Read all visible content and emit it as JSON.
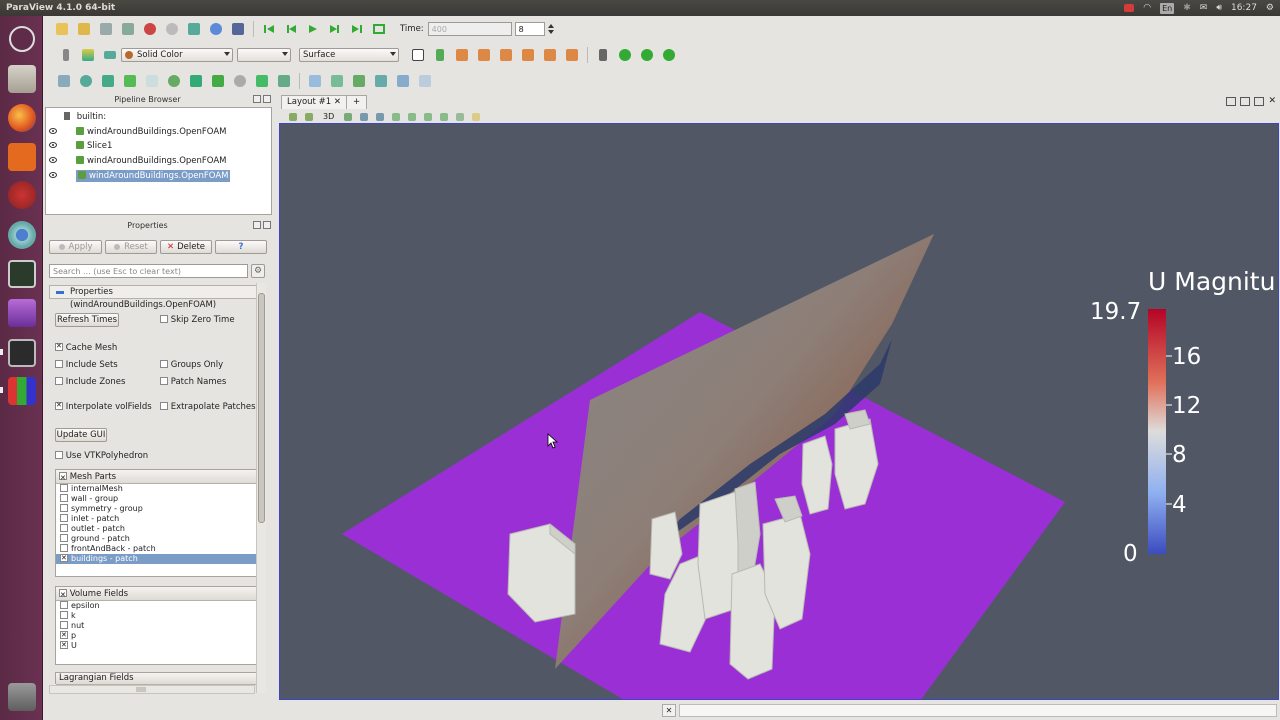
{
  "window_title": "ParaView 4.1.0 64-bit",
  "tray": {
    "lang": "En",
    "time": "16:27"
  },
  "time_toolbar": {
    "label": "Time:",
    "value": "400",
    "step": "8"
  },
  "representation_toolbar": {
    "color_by": "Solid Color",
    "component": "",
    "representation": "Surface"
  },
  "pipeline_browser": {
    "title": "Pipeline Browser",
    "root": "builtin:",
    "items": [
      {
        "label": "windAroundBuildings.OpenFOAM",
        "selected": false
      },
      {
        "label": "Slice1",
        "selected": false
      },
      {
        "label": "windAroundBuildings.OpenFOAM",
        "selected": false
      },
      {
        "label": "windAroundBuildings.OpenFOAM",
        "selected": true
      }
    ]
  },
  "properties_panel": {
    "title": "Properties",
    "apply": "Apply",
    "reset": "Reset",
    "delete": "Delete",
    "help": "?",
    "search_placeholder": "Search ... (use Esc to clear text)",
    "section_header": "Properties (windAroundBuildings.OpenFOAM)",
    "refresh_times": "Refresh Times",
    "skip_zero_time": "Skip Zero Time",
    "cache_mesh": "Cache Mesh",
    "include_sets": "Include Sets",
    "groups_only": "Groups Only",
    "include_zones": "Include Zones",
    "patch_names": "Patch Names",
    "interpolate_volfields": "Interpolate volFields",
    "extrapolate_patches": "Extrapolate Patches",
    "update_gui": "Update GUI",
    "use_vtkpolyhedron": "Use VTKPolyhedron",
    "mesh_parts_header": "Mesh Parts",
    "mesh_parts": [
      {
        "label": "internalMesh",
        "checked": false,
        "selected": false
      },
      {
        "label": "wall - group",
        "checked": false,
        "selected": false
      },
      {
        "label": "symmetry - group",
        "checked": false,
        "selected": false
      },
      {
        "label": "inlet - patch",
        "checked": false,
        "selected": false
      },
      {
        "label": "outlet - patch",
        "checked": false,
        "selected": false
      },
      {
        "label": "ground - patch",
        "checked": false,
        "selected": false
      },
      {
        "label": "frontAndBack - patch",
        "checked": false,
        "selected": false
      },
      {
        "label": "buildings - patch",
        "checked": true,
        "selected": true
      }
    ],
    "volume_fields_header": "Volume Fields",
    "volume_fields": [
      {
        "label": "epsilon",
        "checked": false
      },
      {
        "label": "k",
        "checked": false
      },
      {
        "label": "nut",
        "checked": false
      },
      {
        "label": "p",
        "checked": true
      },
      {
        "label": "U",
        "checked": true
      }
    ],
    "lagrangian_fields_header": "Lagrangian Fields"
  },
  "layout_tab": {
    "label": "Layout #1",
    "add": "+"
  },
  "view_toolbar": {
    "mode_3d": "3D"
  },
  "color_legend": {
    "title": "U Magnitu",
    "max": "19.7",
    "ticks": [
      "16",
      "12",
      "8",
      "4"
    ],
    "min": "0"
  },
  "colors": {
    "ground": "#9b2fd6",
    "background": "#525766",
    "selection": "#7a9cc6",
    "launcher": "#5e2c49"
  }
}
